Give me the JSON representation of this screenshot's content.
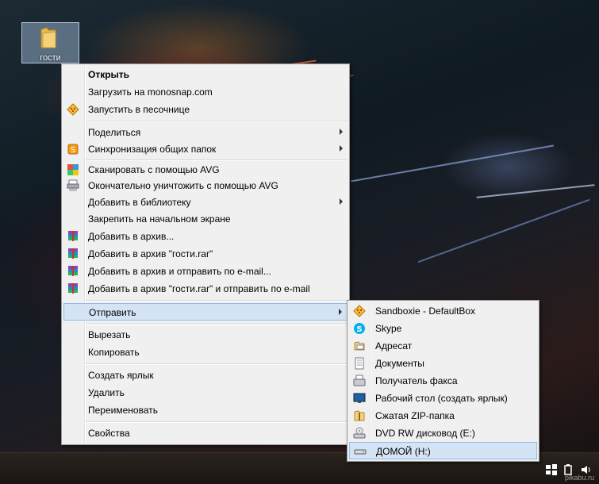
{
  "desktop": {
    "icon_label": "гости"
  },
  "context_menu": {
    "items": [
      {
        "label": "Открыть",
        "bold": true
      },
      {
        "label": "Загрузить на monosnap.com"
      },
      {
        "label": "Запустить в песочнице",
        "icon": "sandboxie-icon"
      },
      {
        "label": "Поделиться",
        "submenu": true
      },
      {
        "label": "Синхронизация общих папок",
        "icon": "sync-icon",
        "submenu": true
      },
      {
        "label": "Сканировать с помощью AVG",
        "icon": "avg-icon"
      },
      {
        "label": "Окончательно уничтожить с помощью AVG",
        "icon": "shredder-icon"
      },
      {
        "label": "Добавить в библиотеку",
        "submenu": true
      },
      {
        "label": "Закрепить на начальном экране"
      },
      {
        "label": "Добавить в архив...",
        "icon": "winrar-icon"
      },
      {
        "label": "Добавить в архив \"гости.rar\"",
        "icon": "winrar-icon"
      },
      {
        "label": "Добавить в архив и отправить по e-mail...",
        "icon": "winrar-icon"
      },
      {
        "label": "Добавить в архив \"гости.rar\" и отправить по e-mail",
        "icon": "winrar-icon"
      },
      {
        "label": "Отправить",
        "submenu": true,
        "highlighted": true
      },
      {
        "label": "Вырезать"
      },
      {
        "label": "Копировать"
      },
      {
        "label": "Создать ярлык"
      },
      {
        "label": "Удалить"
      },
      {
        "label": "Переименовать"
      },
      {
        "label": "Свойства"
      }
    ]
  },
  "send_to_menu": {
    "items": [
      {
        "label": "Sandboxie - DefaultBox",
        "icon": "sandboxie-icon"
      },
      {
        "label": "Skype",
        "icon": "skype-icon"
      },
      {
        "label": "Адресат",
        "icon": "mail-recipient-icon"
      },
      {
        "label": "Документы",
        "icon": "documents-icon"
      },
      {
        "label": "Получатель факса",
        "icon": "fax-icon"
      },
      {
        "label": "Рабочий стол (создать ярлык)",
        "icon": "desktop-icon"
      },
      {
        "label": "Сжатая ZIP-папка",
        "icon": "zip-folder-icon"
      },
      {
        "label": "DVD RW дисковод (E:)",
        "icon": "dvd-drive-icon"
      },
      {
        "label": "ДОМОЙ (H:)",
        "icon": "drive-icon",
        "highlighted": true
      }
    ]
  },
  "watermark": "pikabu.ru",
  "colors": {
    "highlight": "#d5e4f4",
    "highlight_border": "#91bce6"
  }
}
